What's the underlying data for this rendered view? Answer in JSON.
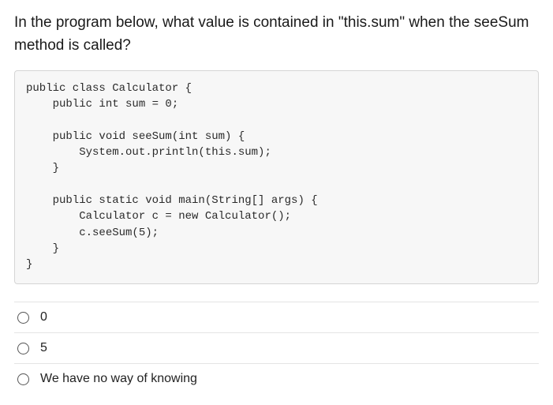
{
  "question": "In the program below, what value is contained in \"this.sum\" when the seeSum method is called?",
  "code": "public class Calculator {\n    public int sum = 0;\n\n    public void seeSum(int sum) {\n        System.out.println(this.sum);\n    }\n\n    public static void main(String[] args) {\n        Calculator c = new Calculator();\n        c.seeSum(5);\n    }\n}",
  "options": [
    {
      "label": "0"
    },
    {
      "label": "5"
    },
    {
      "label": "We have no way of knowing"
    }
  ]
}
